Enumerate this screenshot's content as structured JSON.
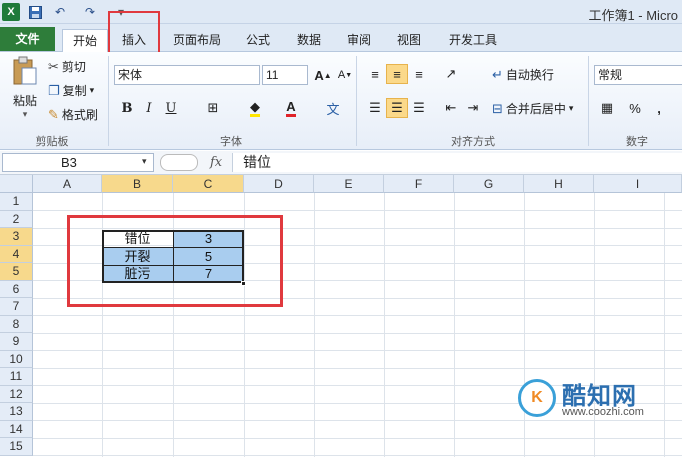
{
  "window": {
    "title": "工作簿1 - Micro"
  },
  "quick_access": {
    "app_icon": "X",
    "save_icon": "save-icon",
    "undo_icon": "undo-icon",
    "redo_icon": "redo-icon"
  },
  "tabs": [
    "文件",
    "开始",
    "插入",
    "页面布局",
    "公式",
    "数据",
    "审阅",
    "视图",
    "开发工具"
  ],
  "ribbon": {
    "clipboard": {
      "paste": "粘贴",
      "cut": "剪切",
      "copy": "复制",
      "format_painter": "格式刷",
      "label": "剪贴板"
    },
    "font": {
      "font_name": "宋体",
      "font_size": "11",
      "grow": "A",
      "shrink": "A",
      "bold": "B",
      "italic": "I",
      "underline": "U",
      "wen": "文",
      "label": "字体"
    },
    "alignment": {
      "wrap": "自动换行",
      "merge": "合并后居中",
      "label": "对齐方式"
    },
    "number": {
      "format": "常规",
      "percent": "%",
      "comma": ",",
      "label": "数字"
    }
  },
  "formula_bar": {
    "name_box": "B3",
    "fx": "fx",
    "content": "错位"
  },
  "columns": [
    "A",
    "B",
    "C",
    "D",
    "E",
    "F",
    "G",
    "H",
    "I"
  ],
  "rows": [
    "1",
    "2",
    "3",
    "4",
    "5",
    "6",
    "7",
    "8",
    "9",
    "10",
    "11",
    "12",
    "13",
    "14",
    "15"
  ],
  "cells": [
    {
      "label": "错位",
      "value": "3"
    },
    {
      "label": "开裂",
      "value": "5"
    },
    {
      "label": "脏污",
      "value": "7"
    }
  ],
  "watermark": {
    "badge": "K",
    "name": "酷知网",
    "url": "www.coozhi.com"
  }
}
